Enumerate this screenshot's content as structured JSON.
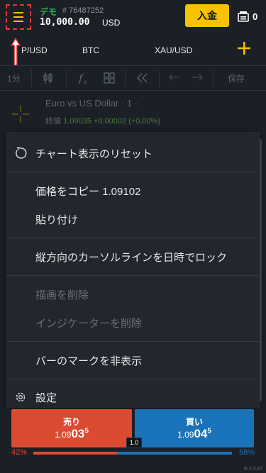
{
  "header": {
    "account_type": "デモ",
    "account_id": "# 76487252",
    "balance": "10,000.00",
    "currency": "USD",
    "deposit_label": "入金",
    "wallet_count": "0"
  },
  "tabs": [
    {
      "label": "P/USD"
    },
    {
      "label": "BTC"
    },
    {
      "label": "XAU/USD"
    }
  ],
  "toolbar": {
    "interval": "1分",
    "save_label": "保存"
  },
  "chart": {
    "title": "Euro vs US Dollar · 1 ·",
    "close_label": "終値",
    "close_value": "1.09035",
    "change": "+0.00002 (+0.00%)"
  },
  "context_menu": {
    "items": [
      {
        "label": "チャート表示のリセット",
        "icon": "reset-icon",
        "enabled": true
      },
      {
        "label": "価格をコピー 1.09102",
        "enabled": true
      },
      {
        "label": "貼り付け",
        "enabled": true
      },
      {
        "label": "縦方向のカーソルラインを日時でロック",
        "enabled": true
      },
      {
        "label": "描画を削除",
        "enabled": false
      },
      {
        "label": "インジケーターを削除",
        "enabled": false
      },
      {
        "label": "バーのマークを非表示",
        "enabled": true
      },
      {
        "label": "設定",
        "icon": "gear-icon",
        "enabled": true
      }
    ]
  },
  "trade": {
    "sell": {
      "label": "売り",
      "price_small": "1.09",
      "price_big": "03",
      "price_sup": "5"
    },
    "buy": {
      "label": "買い",
      "price_small": "1.09",
      "price_big": "04",
      "price_sup": "5"
    },
    "spread": "1.0",
    "sentiment_sell": "42%",
    "sentiment_buy": "58%",
    "sentiment_sell_fraction": 0.42
  },
  "version": "R 2.0.87",
  "colors": {
    "accent": "#f7c300",
    "sell": "#dc4a32",
    "buy": "#1a73b8",
    "demo": "#30b35a"
  }
}
